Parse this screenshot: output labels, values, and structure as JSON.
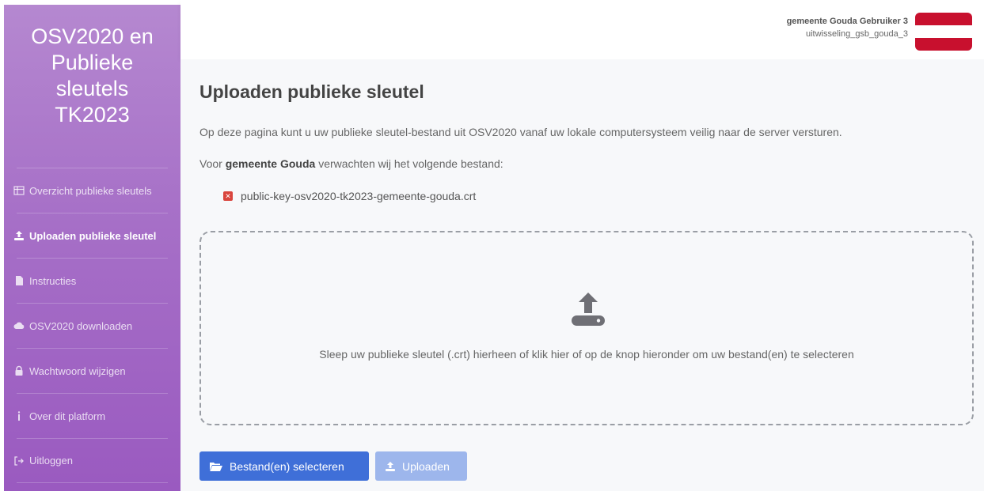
{
  "app": {
    "title": "OSV2020 en Publieke sleutels TK2023"
  },
  "sidebar": {
    "items": [
      {
        "label": "Overzicht publieke sleutels",
        "icon": "table-icon",
        "active": false
      },
      {
        "label": "Uploaden publieke sleutel",
        "icon": "upload-icon",
        "active": true
      },
      {
        "label": "Instructies",
        "icon": "document-icon",
        "active": false
      },
      {
        "label": "OSV2020 downloaden",
        "icon": "cloud-download-icon",
        "active": false
      },
      {
        "label": "Wachtwoord wijzigen",
        "icon": "lock-icon",
        "active": false
      },
      {
        "label": "Over dit platform",
        "icon": "info-icon",
        "active": false
      },
      {
        "label": "Uitloggen",
        "icon": "logout-icon",
        "active": false
      }
    ]
  },
  "header": {
    "user_name": "gemeente Gouda Gebruiker 3",
    "account": "uitwisseling_gsb_gouda_3",
    "flag_colors": [
      "#c8102e",
      "#ffffff",
      "#c8102e"
    ]
  },
  "main": {
    "title": "Uploaden publieke sleutel",
    "intro": "Op deze pagina kunt u uw publieke sleutel-bestand uit OSV2020 vanaf uw lokale computersysteem veilig naar de server versturen.",
    "expect_prefix": "Voor",
    "municipality": "gemeente Gouda",
    "expect_suffix": "verwachten wij het volgende bestand:",
    "expected_file": "public-key-osv2020-tk2023-gemeente-gouda.crt",
    "expected_file_status": "missing",
    "dropzone_text": "Sleep uw publieke sleutel (.crt) hierheen of klik hier of op de knop hieronder om uw bestand(en) te selecteren",
    "select_button": "Bestand(en) selecteren",
    "upload_button": "Uploaden"
  },
  "colors": {
    "sidebar_top": "#b588d0",
    "sidebar_bottom": "#9a5ac0",
    "primary": "#3f6fd8",
    "primary_disabled": "#9db6ec",
    "error": "#d9453d"
  }
}
